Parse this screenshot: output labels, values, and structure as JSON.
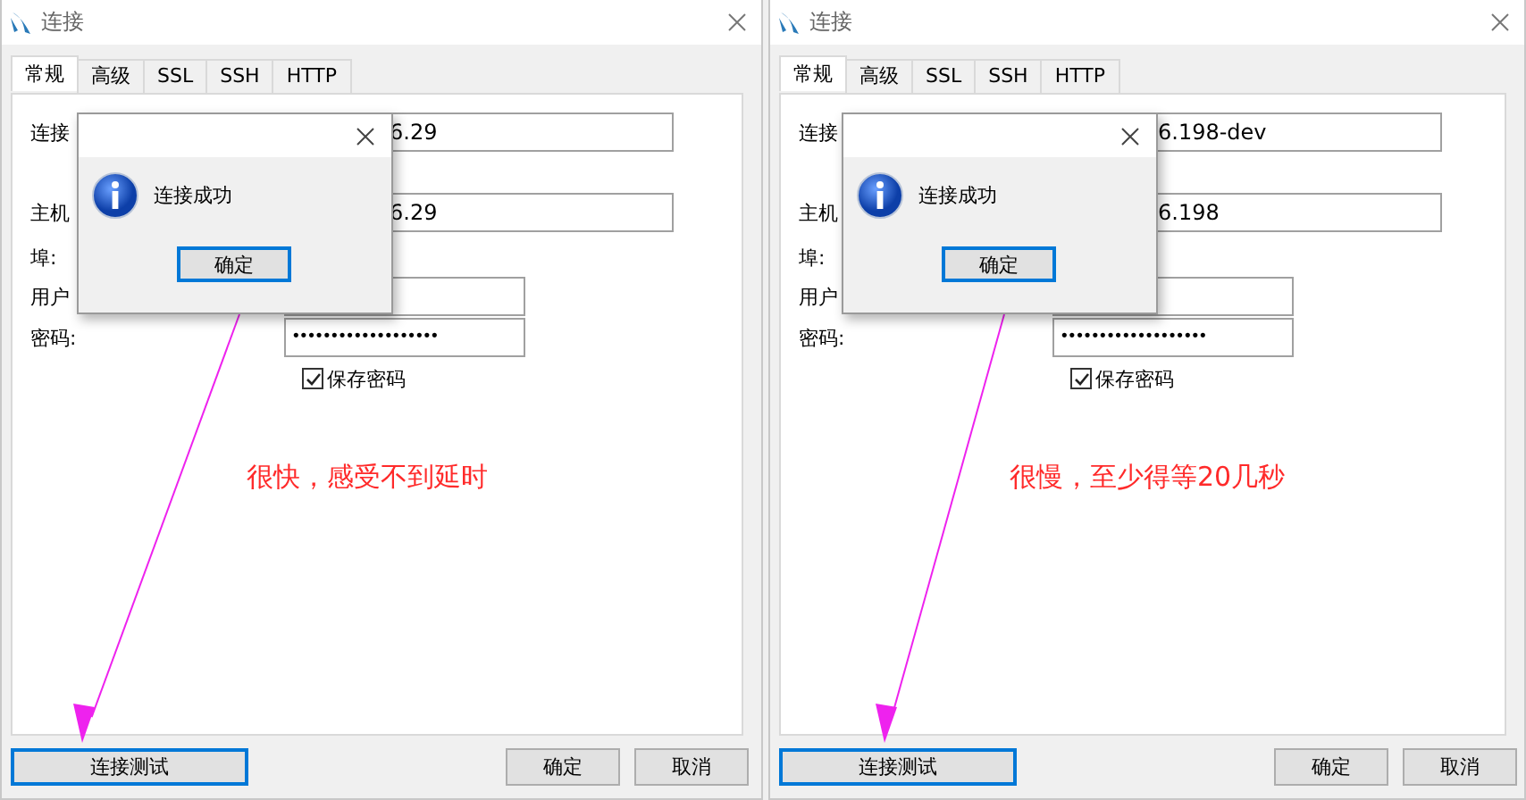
{
  "panels": [
    {
      "window": {
        "title": "连接"
      },
      "tabs": [
        {
          "label": "常规",
          "selected": true
        },
        {
          "label": "高级",
          "selected": false
        },
        {
          "label": "SSL",
          "selected": false
        },
        {
          "label": "SSH",
          "selected": false
        },
        {
          "label": "HTTP",
          "selected": false
        }
      ],
      "fields": [
        {
          "kind": "wide",
          "label": "连接",
          "value": "6.29"
        },
        {
          "kind": "wide",
          "label": "主机",
          "value": "6.29"
        },
        {
          "kind": "none",
          "label": "埠:"
        },
        {
          "kind": "short",
          "label": "用户"
        },
        {
          "kind": "password",
          "label": "密码:",
          "value": "•••••••••••••••••••"
        }
      ],
      "save_password": {
        "label": "保存密码",
        "checked": true
      },
      "message_box": {
        "text": "连接成功",
        "button": "确定"
      },
      "annotation": "很快，感受不到延时",
      "buttons": [
        {
          "label": "连接测试",
          "focused": true
        },
        {
          "label": "确定",
          "focused": false
        },
        {
          "label": "取消",
          "focused": false
        }
      ]
    },
    {
      "window": {
        "title": "连接"
      },
      "tabs": [
        {
          "label": "常规",
          "selected": true
        },
        {
          "label": "高级",
          "selected": false
        },
        {
          "label": "SSL",
          "selected": false
        },
        {
          "label": "SSH",
          "selected": false
        },
        {
          "label": "HTTP",
          "selected": false
        }
      ],
      "fields": [
        {
          "kind": "wide",
          "label": "连接",
          "value": "6.198-dev"
        },
        {
          "kind": "wide",
          "label": "主机",
          "value": "6.198"
        },
        {
          "kind": "none",
          "label": "埠:"
        },
        {
          "kind": "short",
          "label": "用户"
        },
        {
          "kind": "password",
          "label": "密码:",
          "value": "•••••••••••••••••••"
        }
      ],
      "save_password": {
        "label": "保存密码",
        "checked": true
      },
      "message_box": {
        "text": "连接成功",
        "button": "确定"
      },
      "annotation": "很慢，至少得等20几秒",
      "buttons": [
        {
          "label": "连接测试",
          "focused": true
        },
        {
          "label": "确定",
          "focused": false
        },
        {
          "label": "取消",
          "focused": false
        }
      ]
    }
  ]
}
